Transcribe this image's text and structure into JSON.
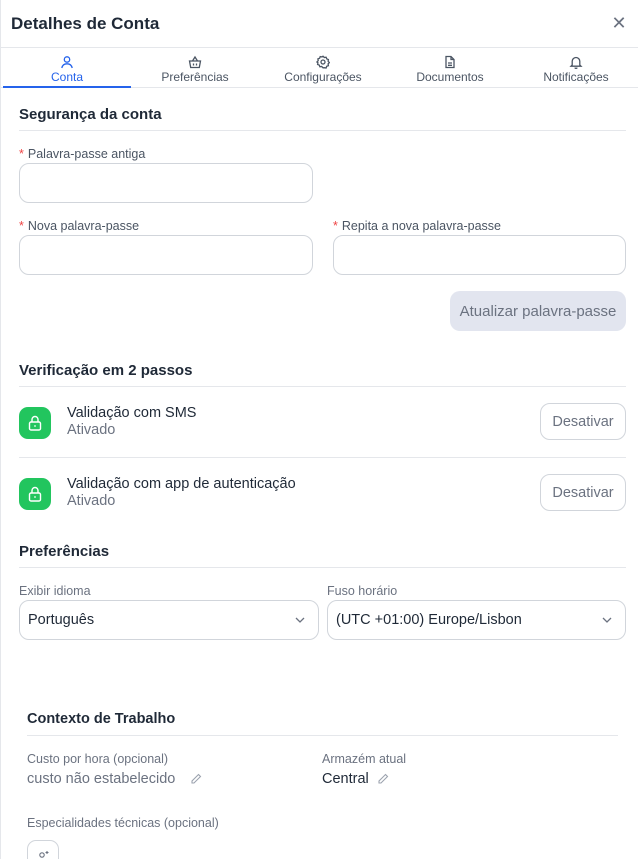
{
  "header": {
    "title": "Detalhes de Conta",
    "close_icon": "close-icon"
  },
  "tabs": [
    {
      "label": "Conta",
      "icon": "user-icon",
      "active": true
    },
    {
      "label": "Preferências",
      "icon": "basket-icon",
      "active": false
    },
    {
      "label": "Configurações",
      "icon": "gear-icon",
      "active": false
    },
    {
      "label": "Documentos",
      "icon": "document-icon",
      "active": false
    },
    {
      "label": "Notificações",
      "icon": "bell-icon",
      "active": false
    }
  ],
  "security": {
    "title": "Segurança da conta",
    "required_mark": "*",
    "old_password_label": "Palavra-passe antiga",
    "new_password_label": "Nova palavra-passe",
    "repeat_password_label": "Repita a nova palavra-passe",
    "update_button": "Atualizar palavra-passe"
  },
  "two_step": {
    "title": "Verificação em 2 passos",
    "items": [
      {
        "title": "Validação com SMS",
        "status": "Ativado",
        "action": "Desativar",
        "icon": "lock-icon"
      },
      {
        "title": "Validação com app de autenticação",
        "status": "Ativado",
        "action": "Desativar",
        "icon": "lock-icon"
      }
    ]
  },
  "preferences": {
    "title": "Preferências",
    "language_label": "Exibir idioma",
    "language_value": "Português",
    "timezone_label": "Fuso horário",
    "timezone_value": "(UTC +01:00) Europe/Lisbon"
  },
  "work_context": {
    "title": "Contexto de Trabalho",
    "hourly_cost_label": "Custo por hora (opcional)",
    "hourly_cost_value": "custo não estabelecido",
    "warehouse_label": "Armazém atual",
    "warehouse_value": "Central",
    "specialties_label": "Especialidades técnicas (opcional)"
  },
  "colors": {
    "accent": "#2563eb",
    "success": "#22c55e",
    "required": "#ef4444",
    "disabled_button": "#e2e5ef"
  }
}
